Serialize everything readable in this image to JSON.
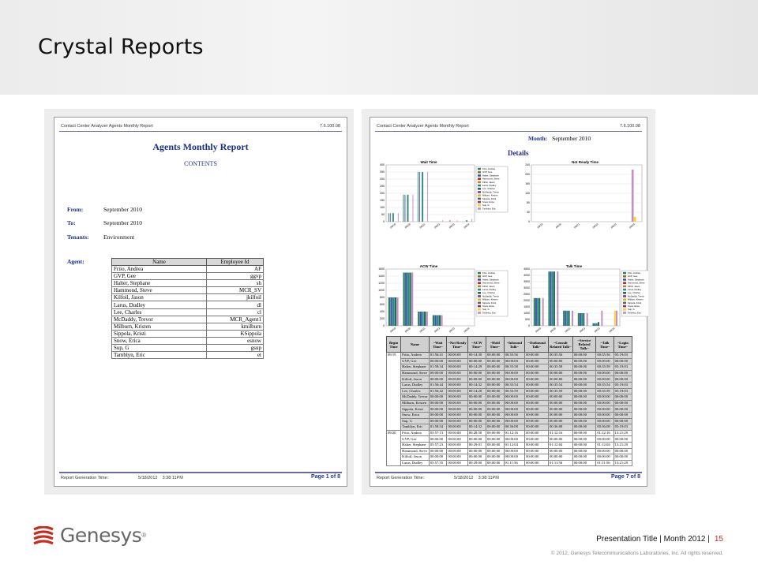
{
  "slide": {
    "title": "Crystal Reports",
    "footer_text": "Presentation Title | Month 2012 |",
    "page_number": "15",
    "copyright": "© 2012, Genesys Telecommunications Laboratories, Inc. All rights reserved.",
    "logo_text": "Genesys",
    "logo_tm": "®"
  },
  "left_report": {
    "header_left": "Contact Center Analyzer Agents Monthly Report",
    "header_right": "7.6.100.08",
    "title": "Agents Monthly Report",
    "contents": "CONTENTS",
    "from_label": "From:",
    "from_value": "September 2010",
    "to_label": "To:",
    "to_value": "September 2010",
    "tenants_label": "Tenants:",
    "tenants_value": "Environment",
    "agent_label": "Agent:",
    "table_headers": [
      "Name",
      "Employee Id"
    ],
    "agents": [
      [
        "Friio, Andrea",
        "AF"
      ],
      [
        "GVP, Gee",
        "ggvp"
      ],
      [
        "Halter, Stephane",
        "sh"
      ],
      [
        "Hammond, Steve",
        "MCR_SV"
      ],
      [
        "Kilfoil, Jason",
        "jkilfoil"
      ],
      [
        "Larus, Dudley",
        "dl"
      ],
      [
        "Lee, Charles",
        "cl"
      ],
      [
        "McDaddy, Trevor",
        "MCR_Agent1"
      ],
      [
        "Milburn, Kristen",
        "kmilburn"
      ],
      [
        "Sippola, Kristi",
        "KSippola"
      ],
      [
        "Snow, Erica",
        "esnow"
      ],
      [
        "Sup, G",
        "gsup"
      ],
      [
        "Tamblyn, Eric",
        "et"
      ]
    ],
    "footer_label": "Report Generation Time:",
    "footer_date": "5/18/2012",
    "footer_time": "3:38:11PM",
    "footer_page": "Page 1 of 8"
  },
  "right_report": {
    "header_left": "Contact Center Analyzer Agents Monthly Report",
    "header_right": "7.6.100.08",
    "month_label": "Month:",
    "month_value": "September 2010",
    "details": "Details",
    "footer_label": "Report Generation Time:",
    "footer_date": "5/18/2012",
    "footer_time": "3:38:11PM",
    "footer_page": "Page 7 of 8",
    "table_headers": [
      "Begin Time",
      "Name",
      "~Wait Time~",
      "~Not Ready Time~",
      "~ACW Time~",
      "~Hold Time~",
      "~Inbound Talk~",
      "~Outbound Talk~",
      "~Consult Related Talk~",
      "~Service Related Talk~",
      "~Talk Time~",
      "~Login Time~"
    ],
    "detail_groups": [
      {
        "begin": "09/19",
        "rows": [
          [
            "Friio, Andrea",
            "01:56:41",
            "00:00:00",
            "00:14:30",
            "00:00:00",
            "00:35:56",
            "00:00:00",
            "00:35:56",
            "00:00:00",
            "00:35:56",
            "05:19:03"
          ],
          [
            "GVP, Gee",
            "00:00:00",
            "00:00:00",
            "00:00:00",
            "00:00:00",
            "00:00:00",
            "00:00:00",
            "00:00:00",
            "00:00:00",
            "00:00:00",
            "00:00:00"
          ],
          [
            "Halter, Stephane",
            "01:58:34",
            "00:00:00",
            "00:14:29",
            "00:00:00",
            "00:35:58",
            "00:00:00",
            "00:35:58",
            "00:00:00",
            "00:35:59",
            "05:19:03"
          ],
          [
            "Hammond, Steve",
            "00:00:00",
            "00:00:00",
            "00:00:00",
            "00:00:00",
            "00:00:00",
            "00:00:00",
            "00:00:00",
            "00:00:00",
            "00:00:00",
            "00:00:00"
          ],
          [
            "Kilfoil, Jason",
            "00:00:00",
            "00:00:00",
            "00:00:00",
            "00:00:00",
            "00:00:00",
            "00:00:00",
            "00:00:00",
            "00:00:00",
            "00:00:00",
            "00:00:00"
          ],
          [
            "Larus, Dudley",
            "01:56:44",
            "00:00:00",
            "00:14:32",
            "00:00:00",
            "00:35:54",
            "00:00:00",
            "00:35:54",
            "00:00:00",
            "00:35:54",
            "05:19:03"
          ],
          [
            "Lee, Charles",
            "01:56:42",
            "00:00:00",
            "00:14:28",
            "00:00:00",
            "00:35:59",
            "00:00:00",
            "00:35:59",
            "00:00:00",
            "00:35:59",
            "05:19:03"
          ],
          [
            "McDaddy, Trevor",
            "00:00:00",
            "00:00:00",
            "00:00:00",
            "00:00:00",
            "00:00:00",
            "00:00:00",
            "00:00:00",
            "00:00:00",
            "00:00:00",
            "00:00:00"
          ],
          [
            "Milburn, Kristen",
            "00:00:00",
            "00:00:00",
            "00:00:00",
            "00:00:00",
            "00:00:00",
            "00:00:00",
            "00:00:00",
            "00:00:00",
            "00:00:00",
            "00:00:00"
          ],
          [
            "Sippola, Kristi",
            "00:00:00",
            "00:00:00",
            "00:00:00",
            "00:00:00",
            "00:00:00",
            "00:00:00",
            "00:00:00",
            "00:00:00",
            "00:00:00",
            "00:00:00"
          ],
          [
            "Snow, Erica",
            "00:00:00",
            "00:00:00",
            "00:00:00",
            "00:00:00",
            "00:00:00",
            "00:00:00",
            "00:00:00",
            "00:00:00",
            "00:00:00",
            "00:00:00"
          ],
          [
            "Sup, G",
            "00:00:00",
            "00:00:00",
            "00:00:00",
            "00:00:00",
            "00:00:00",
            "00:00:00",
            "00:00:00",
            "00:00:00",
            "00:00:00",
            "00:00:00"
          ],
          [
            "Tamblyn, Eric",
            "01:58:34",
            "00:00:00",
            "00:14:32",
            "00:00:00",
            "00:36:08",
            "00:00:00",
            "00:36:08",
            "00:00:00",
            "00:36:08",
            "05:19:03"
          ]
        ]
      },
      {
        "begin": "09/20",
        "rows": [
          [
            "Friio, Andrea",
            "05:57:13",
            "00:00:00",
            "00:28:58",
            "00:00:00",
            "01:12:16",
            "00:00:00",
            "01:12:16",
            "00:00:00",
            "01:12:16",
            "13:21:29"
          ],
          [
            "GVP, Gee",
            "00:00:00",
            "00:00:00",
            "00:00:00",
            "00:00:00",
            "00:00:00",
            "00:00:00",
            "00:00:00",
            "00:00:00",
            "00:00:00",
            "00:00:00"
          ],
          [
            "Halter, Stephane",
            "05:57:23",
            "00:00:00",
            "00:29:01",
            "00:00:00",
            "01:12:04",
            "00:00:00",
            "01:12:04",
            "00:00:00",
            "01:12:04",
            "13:21:29"
          ],
          [
            "Hammond, Steve",
            "00:00:00",
            "00:00:00",
            "00:00:00",
            "00:00:00",
            "00:00:00",
            "00:00:00",
            "00:00:00",
            "00:00:00",
            "00:00:00",
            "00:00:00"
          ],
          [
            "Kilfoil, Jason",
            "00:00:00",
            "00:00:00",
            "00:00:00",
            "00:00:00",
            "00:00:00",
            "00:00:00",
            "00:00:00",
            "00:00:00",
            "00:00:00",
            "00:00:00"
          ],
          [
            "Larus, Dudley",
            "05:57:35",
            "00:00:00",
            "00:29:00",
            "00:00:00",
            "01:11:56",
            "00:00:00",
            "01:11:56",
            "00:00:00",
            "01:11:56",
            "13:21:29"
          ]
        ]
      }
    ]
  },
  "chart_data": [
    {
      "type": "bar",
      "title": "Wait Time",
      "categories": [
        "09/19",
        "09/20",
        "09/21",
        "09/22",
        "09/23",
        "09/24"
      ],
      "yticks": [
        0,
        50,
        100,
        150,
        200,
        250,
        300,
        350,
        400
      ],
      "ylim": [
        0,
        400
      ],
      "series": [
        {
          "name": "Friio, Andrea",
          "values": [
            60,
            190,
            350,
            0,
            0,
            0
          ]
        },
        {
          "name": "GVP, Gee",
          "values": [
            0,
            0,
            0,
            0,
            0,
            0
          ]
        },
        {
          "name": "Halter, Stephane",
          "values": [
            60,
            190,
            350,
            0,
            0,
            0
          ]
        },
        {
          "name": "Hammond, Steve",
          "values": [
            0,
            0,
            0,
            0,
            10,
            0
          ]
        },
        {
          "name": "Kilfoil, Jason",
          "values": [
            0,
            0,
            0,
            0,
            0,
            0
          ]
        },
        {
          "name": "Larus, Dudley",
          "values": [
            60,
            190,
            350,
            0,
            0,
            10
          ]
        },
        {
          "name": "Lee, Charles",
          "values": [
            60,
            190,
            350,
            0,
            0,
            10
          ]
        },
        {
          "name": "McDaddy, Trevor",
          "values": [
            0,
            0,
            0,
            0,
            0,
            0
          ]
        },
        {
          "name": "Milburn, Kristen",
          "values": [
            0,
            0,
            0,
            0,
            0,
            0
          ]
        },
        {
          "name": "Sippola, Kristi",
          "values": [
            0,
            0,
            0,
            0,
            0,
            0
          ]
        },
        {
          "name": "Snow, Erica",
          "values": [
            0,
            0,
            0,
            0,
            0,
            0
          ]
        },
        {
          "name": "Sup, G",
          "values": [
            0,
            0,
            0,
            0,
            0,
            0
          ]
        },
        {
          "name": "Tamblyn, Eric",
          "values": [
            60,
            190,
            350,
            10,
            10,
            20
          ]
        }
      ]
    },
    {
      "type": "bar",
      "title": "Not Ready Time",
      "categories": [
        "09/19",
        "09/20",
        "09/21",
        "09/22",
        "09/23",
        "09/24"
      ],
      "yticks": [
        0,
        40,
        80,
        120,
        160,
        200,
        240
      ],
      "ylim": [
        0,
        240
      ],
      "series": [
        {
          "name": "Friio, Andrea",
          "values": [
            0,
            0,
            0,
            0,
            0,
            0
          ]
        },
        {
          "name": "Tamblyn, Eric",
          "values": [
            0,
            0,
            0,
            0,
            0,
            220
          ]
        },
        {
          "name": "Sup, G",
          "values": [
            0,
            0,
            0,
            0,
            0,
            20
          ]
        }
      ]
    },
    {
      "type": "bar",
      "title": "ACW Time",
      "categories": [
        "09/19",
        "09/20",
        "09/21",
        "09/22",
        "09/23",
        "09/24"
      ],
      "yticks": [
        0,
        200,
        400,
        600,
        800,
        1000,
        1200,
        1400,
        1600
      ],
      "ylim": [
        0,
        1600
      ],
      "series": [
        {
          "name": "Friio, Andrea",
          "values": [
            800,
            1500,
            400,
            300,
            0,
            0
          ]
        },
        {
          "name": "Halter, Stephane",
          "values": [
            800,
            1500,
            400,
            300,
            0,
            0
          ]
        },
        {
          "name": "Larus, Dudley",
          "values": [
            800,
            1500,
            400,
            300,
            0,
            0
          ]
        },
        {
          "name": "Lee, Charles",
          "values": [
            800,
            1500,
            400,
            300,
            0,
            0
          ]
        },
        {
          "name": "Tamblyn, Eric",
          "values": [
            800,
            1500,
            400,
            300,
            0,
            0
          ]
        }
      ]
    },
    {
      "type": "bar",
      "title": "Talk Time",
      "categories": [
        "09/19",
        "09/20",
        "09/21",
        "09/22",
        "09/23",
        "09/24"
      ],
      "yticks": [
        0,
        500,
        1000,
        1500,
        2000,
        2500,
        3000,
        3500,
        4000,
        4500
      ],
      "ylim": [
        0,
        4500
      ],
      "series": [
        {
          "name": "Friio, Andrea",
          "values": [
            2200,
            4300,
            1200,
            1000,
            200,
            0
          ]
        },
        {
          "name": "Halter, Stephane",
          "values": [
            2200,
            4300,
            1200,
            1000,
            200,
            0
          ]
        },
        {
          "name": "Larus, Dudley",
          "values": [
            2200,
            4300,
            1200,
            1000,
            200,
            0
          ]
        },
        {
          "name": "Lee, Charles",
          "values": [
            2200,
            4300,
            1200,
            1000,
            300,
            0
          ]
        },
        {
          "name": "Sup, G",
          "values": [
            0,
            0,
            0,
            0,
            0,
            1200
          ]
        },
        {
          "name": "Tamblyn, Eric",
          "values": [
            2200,
            4300,
            1200,
            1000,
            1200,
            1200
          ]
        }
      ]
    }
  ],
  "legend_names": [
    "Friio, Andrea",
    "GVP, Gee",
    "Halter, Stephane",
    "Hammond, Steve",
    "Kilfoil, Jason",
    "Larus, Dudley",
    "Lee, Charles",
    "McDaddy, Trevor",
    "Milburn, Kristen",
    "Sippola, Kristi",
    "Snow, Erica",
    "Sup, G",
    "Tamblyn, Eric"
  ],
  "colors": {
    "Friio, Andrea": "#2f7f5f",
    "GVP, Gee": "#7a7a2a",
    "Halter, Stephane": "#3b56a8",
    "Hammond, Steve": "#b03030",
    "Kilfoil, Jason": "#d07a20",
    "Larus, Dudley": "#2e8b8b",
    "Lee, Charles": "#1e6e5a",
    "McDaddy, Trevor": "#8a3a8a",
    "Milburn, Kristen": "#c0c030",
    "Sippola, Kristi": "#606060",
    "Snow, Erica": "#9a2f5a",
    "Sup, G": "#ffcc33",
    "Tamblyn, Eric": "#c38fc0",
    "brand_red": "#cc2a1e",
    "report_blue": "#1b2f8a"
  }
}
